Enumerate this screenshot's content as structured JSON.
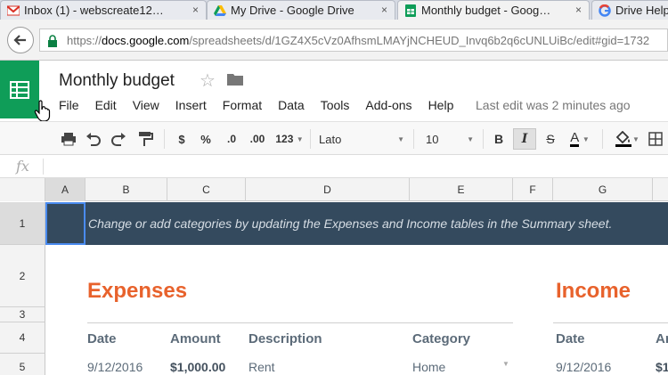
{
  "browser": {
    "tabs": [
      {
        "title": "Inbox (1) - webscreate12…",
        "icon": "gmail-icon",
        "close": "×"
      },
      {
        "title": "My Drive - Google Drive",
        "icon": "drive-icon",
        "close": "×"
      },
      {
        "title": "Monthly budget - Goog…",
        "icon": "sheets-icon",
        "close": "×",
        "active": true
      },
      {
        "title": "Drive Help",
        "icon": "google-icon"
      }
    ],
    "url": {
      "protocol": "https://",
      "host": "docs.google.com",
      "path": "/spreadsheets/d/1GZ4X5cVz0AfhsmLMAYjNCHEUD_Invq6b2q6cUNLUiBc/edit#gid=1732"
    }
  },
  "doc": {
    "title": "Monthly budget",
    "menus": [
      "File",
      "Edit",
      "View",
      "Insert",
      "Format",
      "Data",
      "Tools",
      "Add-ons",
      "Help"
    ],
    "last_edit": "Last edit was 2 minutes ago"
  },
  "toolbar": {
    "currency": "$",
    "percent": "%",
    "dec_decrease": ".0",
    "dec_increase": ".00",
    "number_format": "123",
    "font": "Lato",
    "font_size": "10",
    "bold": "B",
    "italic": "I",
    "strikethrough": "S",
    "text_color": "A"
  },
  "formula": {
    "fx": "fx"
  },
  "grid": {
    "columns": [
      "A",
      "B",
      "C",
      "D",
      "E",
      "F",
      "G"
    ],
    "rows": [
      "1",
      "2",
      "3",
      "4",
      "5"
    ],
    "banner": "Change or add categories by updating the Expenses and Income tables in the Summary sheet."
  },
  "expenses": {
    "title": "Expenses",
    "headers": {
      "date": "Date",
      "amount": "Amount",
      "description": "Description",
      "category": "Category"
    },
    "row1": {
      "date": "9/12/2016",
      "amount": "$1,000.00",
      "description": "Rent",
      "category": "Home"
    }
  },
  "income": {
    "title": "Income",
    "headers": {
      "date": "Date",
      "amount": "Am"
    },
    "row1": {
      "date": "9/12/2016",
      "amount": "$1"
    }
  },
  "colors": {
    "sheets_green": "#0f9d58",
    "banner": "#344a5e",
    "accent_orange": "#e8622c",
    "selection_blue": "#4a8bf0"
  }
}
